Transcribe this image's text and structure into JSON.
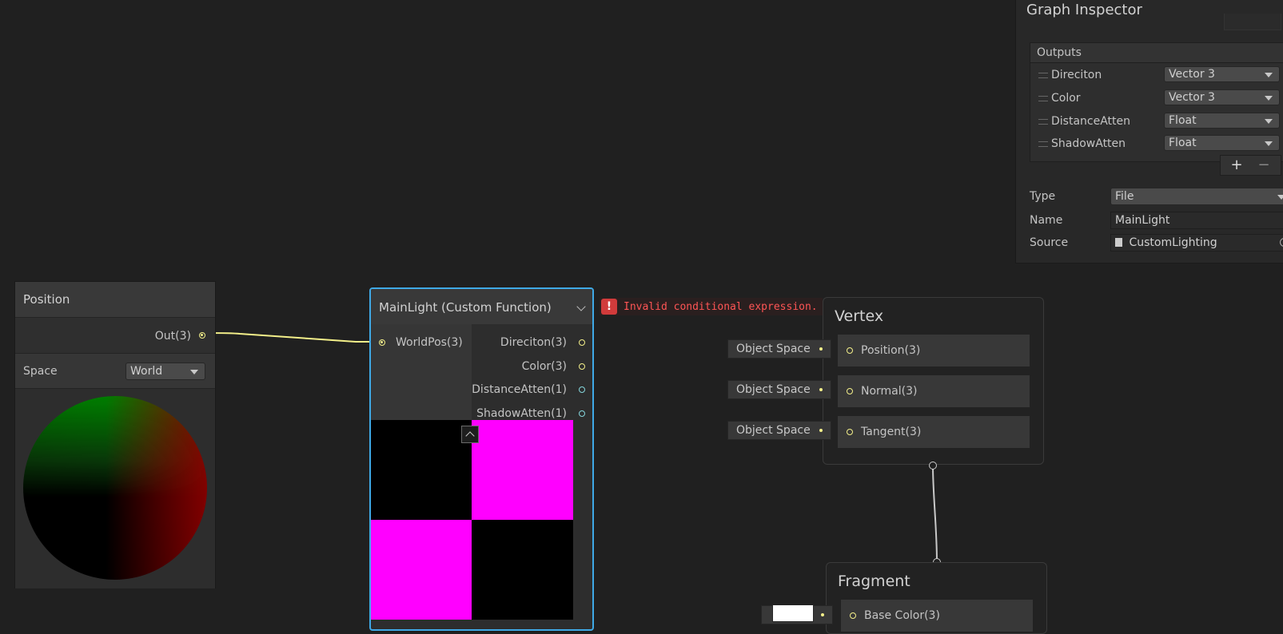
{
  "position_node": {
    "title": "Position",
    "output_label": "Out(3)",
    "space_label": "Space",
    "space_value": "World"
  },
  "custom_function_node": {
    "title": "MainLight (Custom Function)",
    "inputs": [
      {
        "label": "WorldPos(3)"
      }
    ],
    "outputs": [
      {
        "label": "Direciton(3)",
        "port_color": "#f4f08a"
      },
      {
        "label": "Color(3)",
        "port_color": "#f4f08a"
      },
      {
        "label": "DistanceAtten(1)",
        "port_color": "#85d6dc"
      },
      {
        "label": "ShadowAtten(1)",
        "port_color": "#85d6dc"
      }
    ],
    "error_message": "Invalid conditional expression."
  },
  "vertex_context": {
    "title": "Vertex",
    "blocks": [
      {
        "label": "Position(3)",
        "space": "Object Space"
      },
      {
        "label": "Normal(3)",
        "space": "Object Space"
      },
      {
        "label": "Tangent(3)",
        "space": "Object Space"
      }
    ]
  },
  "fragment_context": {
    "title": "Fragment",
    "blocks": [
      {
        "label": "Base Color(3)"
      }
    ]
  },
  "inspector": {
    "title": "Graph Inspector",
    "outputs_header": "Outputs",
    "outputs": [
      {
        "name": "Direciton",
        "type": "Vector 3"
      },
      {
        "name": "Color",
        "type": "Vector 3"
      },
      {
        "name": "DistanceAtten",
        "type": "Float"
      },
      {
        "name": "ShadowAtten",
        "type": "Float"
      }
    ],
    "add_label": "+",
    "remove_label": "−",
    "type_label": "Type",
    "type_value": "File",
    "name_label": "Name",
    "name_value": "MainLight",
    "source_label": "Source",
    "source_value": "CustomLighting"
  },
  "colors": {
    "selection": "#3fa9e6",
    "vector_port": "#f4f08a",
    "float_port": "#85d6dc",
    "error": "#ff5555",
    "preview_magenta": "#ff00ff"
  }
}
